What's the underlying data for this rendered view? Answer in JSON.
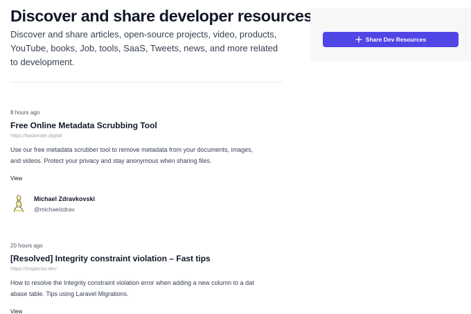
{
  "header": {
    "title": "Discover and share developer resources",
    "description": "Discover and share articles, open-source projects, video, products, YouTube, books, Job, tools, SaaS, Tweets, news, and more related to development."
  },
  "sidebar": {
    "share_button_label": "Share Dev Resources",
    "share_button_icon": "plus-icon"
  },
  "posts": [
    {
      "time": "8 hours ago",
      "title": "Free Online Metadata Scrubbing Tool",
      "url": "https://taskmate.digital",
      "description": "Use our free metadata scrubber tool to remove metadata from your documents, images, and videos. Protect your privacy and stay anonymous when sharing files.",
      "view_label": "View",
      "author": {
        "name": "Michael Zdravkovski",
        "handle": "@michaelzdrav"
      }
    },
    {
      "time": "20 hours ago",
      "title": "[Resolved] Integrity constraint violation – Fast tips",
      "url": "https://inspector.dev",
      "description": "How to resolve the Integrity constraint violation error when adding a new column to a dat abase table. Tips using Laravel Migrations.",
      "view_label": "View"
    }
  ],
  "colors": {
    "accent": "#5045e5",
    "text": "#111827",
    "muted": "#9ca3af",
    "sidebar_bg": "#f7f7f8"
  }
}
